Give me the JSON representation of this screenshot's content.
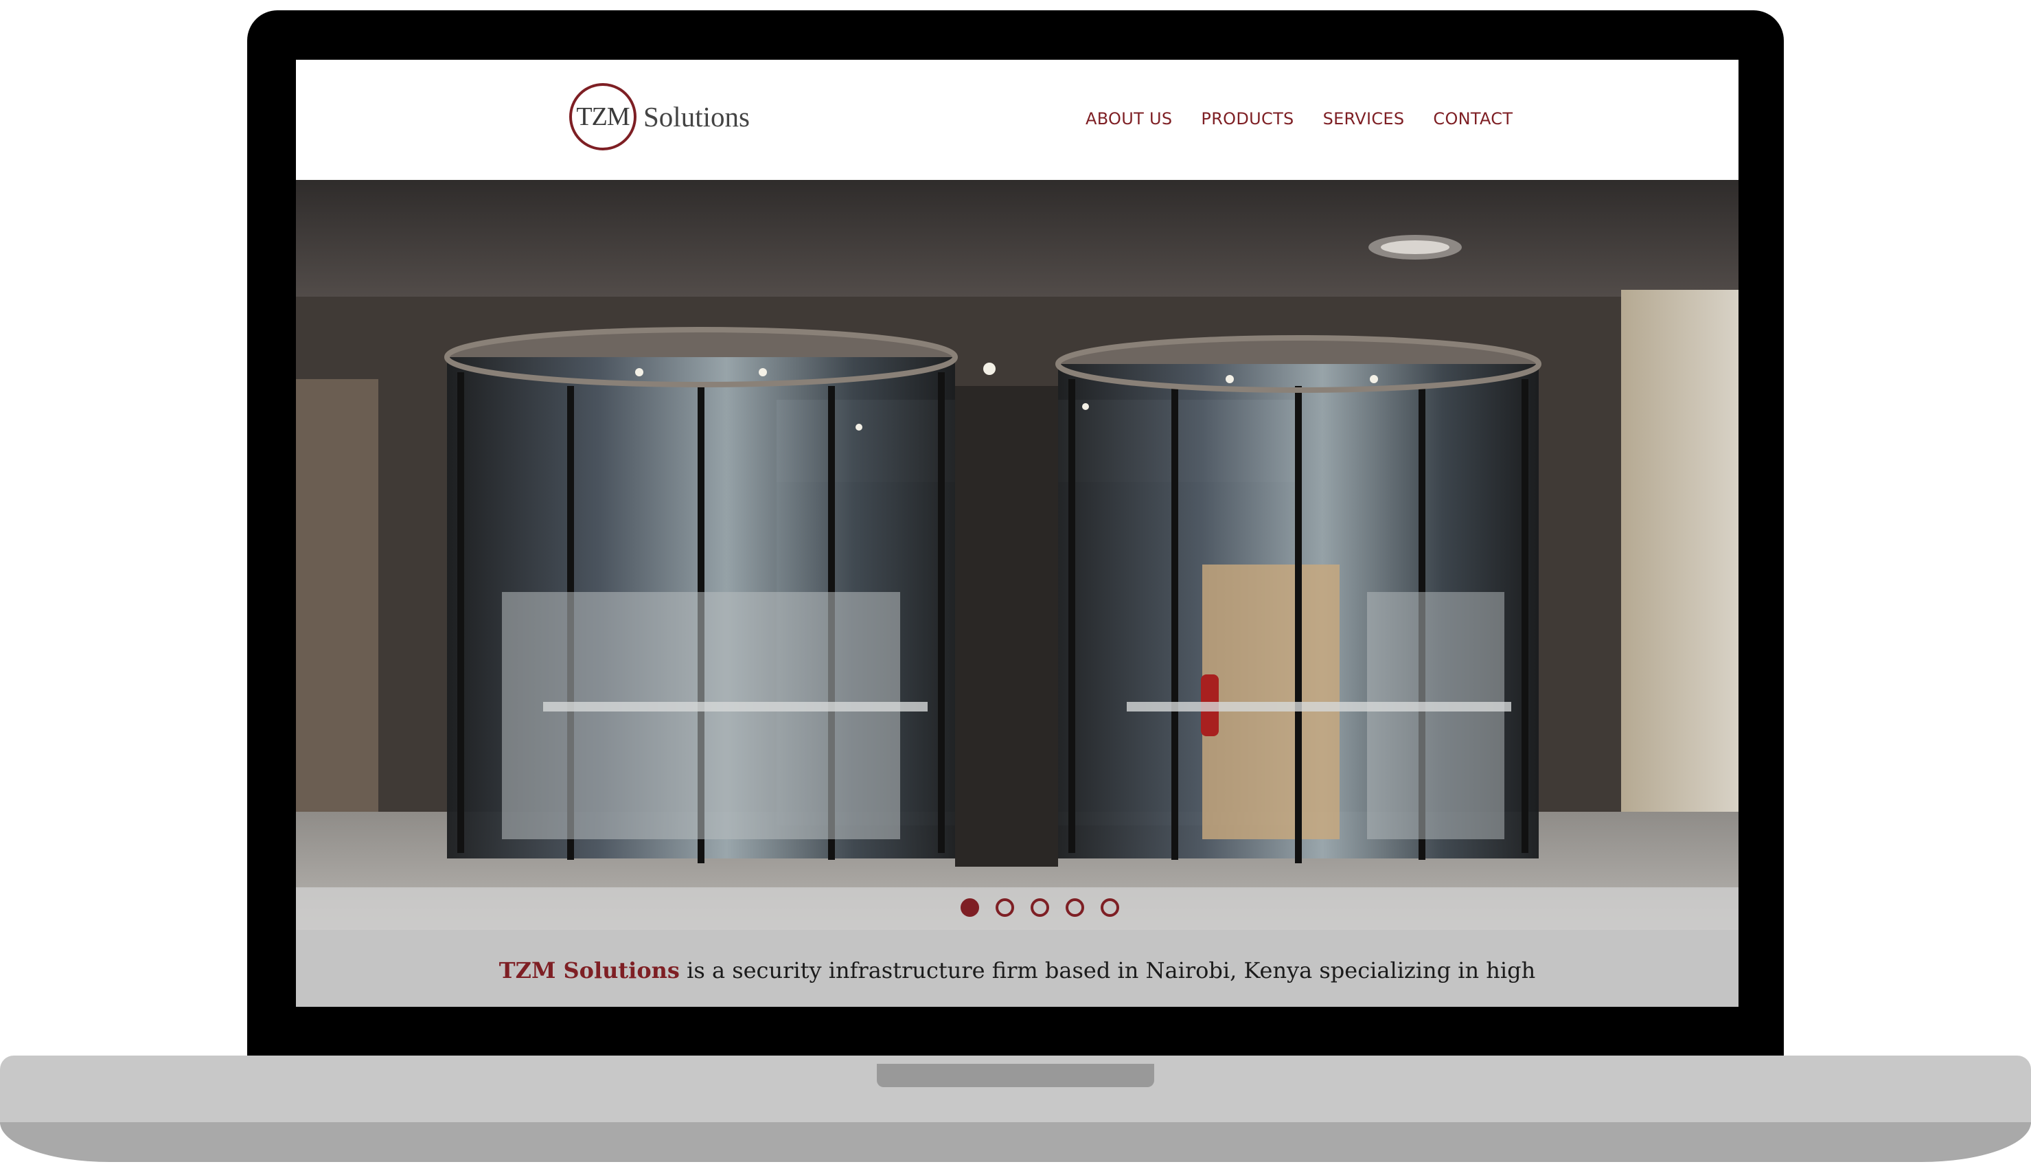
{
  "site": {
    "logo_mark": "TZM",
    "logo_word": "Solutions"
  },
  "nav": {
    "about": "ABOUT US",
    "products": "PRODUCTS",
    "services": "SERVICES",
    "contact": "CONTACT"
  },
  "hero": {
    "image": "revolving-glass-doors-photo",
    "slide_count": 5,
    "active_slide": 1
  },
  "intro": {
    "brand": "TZM Solutions",
    "text": " is a security infrastructure firm based in Nairobi, Kenya specializing in high"
  },
  "colors": {
    "brand": "#7e1f24",
    "bezel": "#000000",
    "laptop_base": "#c8c8c8"
  }
}
